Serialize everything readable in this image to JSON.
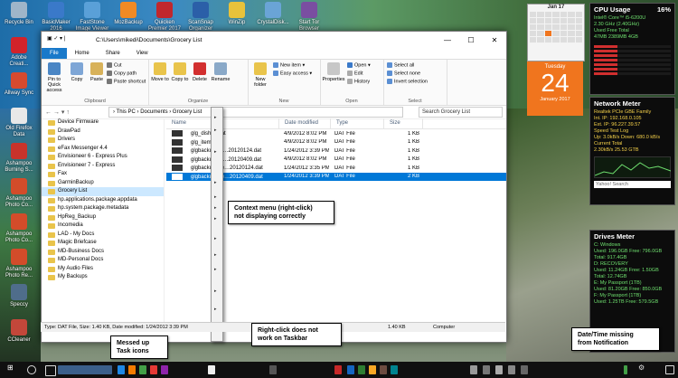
{
  "window": {
    "path": "C:\\Users\\mikedi\\Documents\\Grocery List",
    "controls": [
      "—",
      "☐",
      "✕"
    ]
  },
  "ribbon_tabs": [
    "File",
    "Home",
    "Share",
    "View"
  ],
  "ribbon": {
    "pin": "Pin to Quick access",
    "copy": "Copy",
    "paste": "Paste",
    "cut": "Cut",
    "copy_path": "Copy path",
    "paste_shortcut": "Paste shortcut",
    "clipboard": "Clipboard",
    "move_to": "Move to",
    "copy_to": "Copy to",
    "delete": "Delete",
    "rename": "Rename",
    "organize": "Organize",
    "new_folder": "New folder",
    "new_item": "New item ▾",
    "easy_access": "Easy access ▾",
    "new": "New",
    "properties": "Properties",
    "open_btn": "Open ▾",
    "edit": "Edit",
    "history": "History",
    "open": "Open",
    "select_all": "Select all",
    "select_none": "Select none",
    "invert_selection": "Invert selection",
    "select": "Select"
  },
  "address": {
    "nav": "← → ▾ ↑",
    "crumbs": "› This PC › Documents › Grocery List",
    "search_placeholder": "Search Grocery List"
  },
  "nav_items": [
    "Device Firmware",
    "DrawPad",
    "Drivers",
    "eFax Messenger 4.4",
    "Envisioneer 6 - Express Plus",
    "Envisioneer 7 - Express",
    "Fax",
    "GarminBackup",
    "Grocery List",
    "hp.applications.package.appdata",
    "hp.system.package.metadata",
    "HpReg_Backup",
    "Incomedia",
    "LAD - My Docs",
    "Magic Briefcase",
    "MD-Business Docs",
    "MD-Personal Docs",
    "My Audio Files",
    "My Backups"
  ],
  "columns": [
    "Name",
    "Date modified",
    "Type",
    "Size"
  ],
  "files": [
    {
      "name": "glg_dishes.dat",
      "date": "4/9/2012 8:02 PM",
      "type": "DAT File",
      "size": "1 KB"
    },
    {
      "name": "glg_items.dat",
      "date": "4/9/2012 8:02 PM",
      "type": "DAT File",
      "size": "1 KB"
    },
    {
      "name": "glgbackup_di…20120124.dat",
      "date": "1/24/2012 3:39 PM",
      "type": "DAT File",
      "size": "1 KB"
    },
    {
      "name": "glgbackup_di…20120409.dat",
      "date": "4/9/2012 8:02 PM",
      "type": "DAT File",
      "size": "1 KB"
    },
    {
      "name": "glgbackup_ite…20120124.dat",
      "date": "1/24/2012 3:35 PM",
      "type": "DAT File",
      "size": "1 KB"
    },
    {
      "name": "glgbackup_ite…20120409.dat",
      "date": "1/24/2012 3:39 PM",
      "type": "DAT File",
      "size": "2 KB"
    }
  ],
  "status": {
    "items": "8 items",
    "selected": "1 item selected  1.40 KB"
  },
  "details": {
    "text": "Type: DAT File, Size: 1.40 KB, Date modified: 1/24/2012 3:39 PM",
    "size": "1.40 KB",
    "location": "Computer"
  },
  "callouts": {
    "context": "Context menu (right-click)\nnot displaying correctly",
    "taskicons": "Messed up\nTask icons",
    "taskbar": "Right-click does not\nwork on Taskbar",
    "datetime": "Date/Time missing\nfrom Notification"
  },
  "desktop_icons": [
    {
      "label": "Recycle Bin",
      "color": "#9fb5c9"
    },
    {
      "label": "Adobe Creati...",
      "color": "#d2232a"
    },
    {
      "label": "Allway Sync",
      "color": "#d64a2f"
    },
    {
      "label": "Old Firefox Data",
      "color": "#e8e8e8"
    },
    {
      "label": "Ashampoo Burning S...",
      "color": "#c8332b"
    },
    {
      "label": "Ashampoo Photo Co...",
      "color": "#d34c2a"
    },
    {
      "label": "Ashampoo Photo Co...",
      "color": "#d34c2a"
    },
    {
      "label": "Ashampoo Photo Re...",
      "color": "#d34c2a"
    },
    {
      "label": "Speccy",
      "color": "#4f6d8b"
    },
    {
      "label": "CCleaner",
      "color": "#c3473a"
    }
  ],
  "top_icons": [
    {
      "label": "BasicMaker 2016",
      "color": "#3a79c9"
    },
    {
      "label": "FastStone Image Viewer",
      "color": "#5aa0d8"
    },
    {
      "label": "MozBackup",
      "color": "#f08a24"
    },
    {
      "label": "Quicken Premier 2017",
      "color": "#c0272d"
    },
    {
      "label": "ScanSnap Organizer",
      "color": "#2b5fa8"
    },
    {
      "label": "WinZip",
      "color": "#e8c23b"
    },
    {
      "label": "CrystalDisk...",
      "color": "#6aa4d6"
    },
    {
      "label": "Start Tor Browser",
      "color": "#7a4ea1"
    }
  ],
  "calendar": {
    "month": "Jan 17",
    "day_name": "Tuesday",
    "day": "24",
    "month_year": "January 2017"
  },
  "cpu": {
    "title": "CPU Usage",
    "pct": "16%",
    "lines": [
      "Intel® Core™ i5-6200U",
      "2.30 GHz (2.40GHz)",
      "Used  Free  Total",
      "47MB  2389MB  4GB"
    ]
  },
  "network": {
    "title": "Network Meter",
    "lines": [
      "Realtek PCIe GBE Family",
      "Int. IP: 192.168.0.105",
      "Ext. IP: 96.227.39.57",
      "Speed Test  Log",
      "Up: 3.0kB/s  Down: 680.0 kB/s",
      "Current  Total",
      "2.30kB/s  25.53 GTB"
    ],
    "search": "Yahoo! Search"
  },
  "drives": {
    "title": "Drives Meter",
    "lines": [
      "C: Windows",
      "Used: 196.0GB  Free: 796.0GB",
      "Total: 917.4GB",
      "D: RECOVERY",
      "Used: 11.24GB  Free: 1.50GB",
      "Total: 12.74GB",
      "E: My Passport (1TB)",
      "Used: 81.20GB  Free: 850.0GB",
      "F: My Passport (1TB)",
      "Used: 1.25TB  Free: 579.5GB"
    ]
  }
}
